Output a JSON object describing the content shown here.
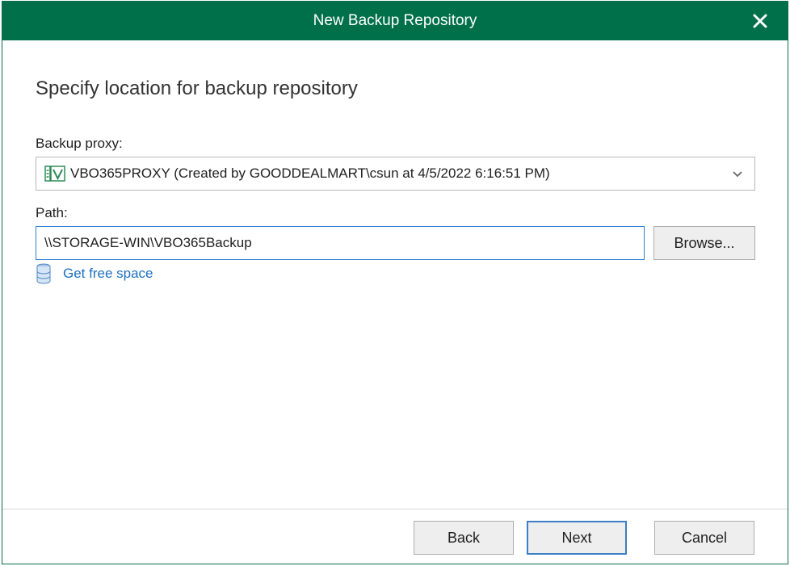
{
  "window": {
    "title": "New Backup Repository",
    "close_icon": "close-icon"
  },
  "page": {
    "heading": "Specify location for backup repository"
  },
  "proxy": {
    "label": "Backup proxy:",
    "selected": "VBO365PROXY (Created by GOODDEALMART\\csun at 4/5/2022 6:16:51 PM)",
    "icon": "vbo-proxy-icon"
  },
  "path": {
    "label": "Path:",
    "value": "\\\\STORAGE-WIN\\VBO365Backup",
    "browse_label": "Browse..."
  },
  "free_space": {
    "link_label": "Get free space",
    "icon": "database-icon"
  },
  "footer": {
    "back_label": "Back",
    "next_label": "Next",
    "cancel_label": "Cancel"
  },
  "colors": {
    "titlebar": "#00704a",
    "link": "#1d6fbf",
    "focus_border": "#2a7fd4"
  }
}
